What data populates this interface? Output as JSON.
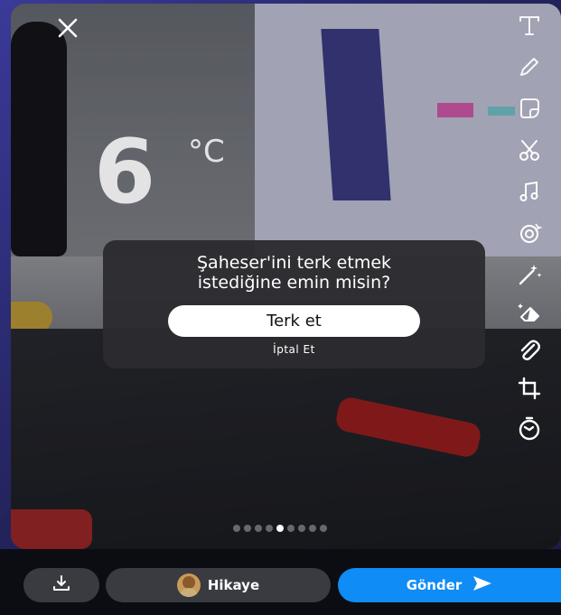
{
  "overlay": {
    "temperature_value": "6",
    "temperature_unit": "°C"
  },
  "toolbar": {
    "icons": [
      "text-icon",
      "pencil-icon",
      "sticker-icon",
      "scissors-icon",
      "music-icon",
      "lens-icon",
      "magic-wand-icon",
      "eraser-icon",
      "paperclip-icon",
      "crop-icon",
      "timer-icon"
    ]
  },
  "dialog": {
    "message_line1": "Şaheser'ini terk etmek",
    "message_line2": "istediğine emin misin?",
    "leave_label": "Terk et",
    "cancel_label": "İptal Et"
  },
  "pager": {
    "total": 9,
    "active": 4
  },
  "bottom_bar": {
    "story_label": "Hikaye",
    "send_label": "Gönder",
    "send_color": "#0f8cf5"
  }
}
